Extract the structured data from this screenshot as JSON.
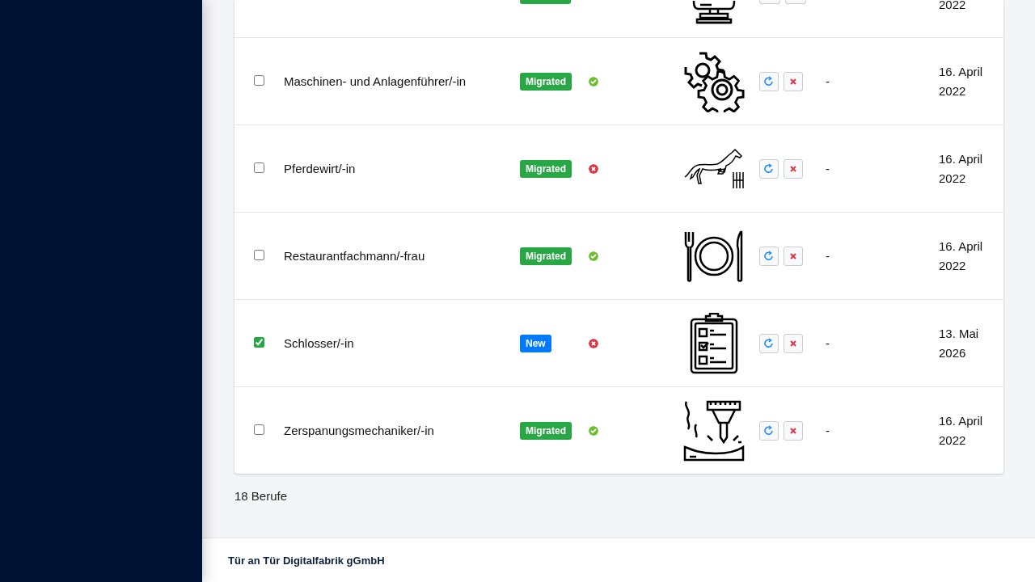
{
  "table": {
    "partial_row": {
      "color": "#28a745",
      "date": "2022"
    },
    "rows": [
      {
        "checked": false,
        "name": "Maschinen- und Anlagenführer/-in",
        "badge": "Migrated",
        "color": "#28a745",
        "ok": true,
        "column_6": "-",
        "date": "16. April 2022"
      },
      {
        "checked": false,
        "name": "Pferdewirt/-in",
        "badge": "Migrated",
        "color": "#28a745",
        "ok": false,
        "column_6": "-",
        "date": "16. April 2022"
      },
      {
        "checked": false,
        "name": "Restaurantfachmann/-frau",
        "badge": "Migrated",
        "color": "#28a745",
        "ok": true,
        "column_6": "-",
        "date": "16. April 2022"
      },
      {
        "checked": true,
        "name": "Schlosser/-in",
        "badge": "New",
        "color": "#007bff",
        "ok": false,
        "column_6": "-",
        "date": "13. Mai 2026"
      },
      {
        "checked": false,
        "name": "Zerspanungsmechaniker/-in",
        "badge": "Migrated",
        "color": "#28a745",
        "ok": true,
        "column_6": "-",
        "date": "16. April 2022"
      }
    ]
  },
  "count": "18 Berufe",
  "footer": "Tür an Tür Digitalfabrik gGmbH"
}
